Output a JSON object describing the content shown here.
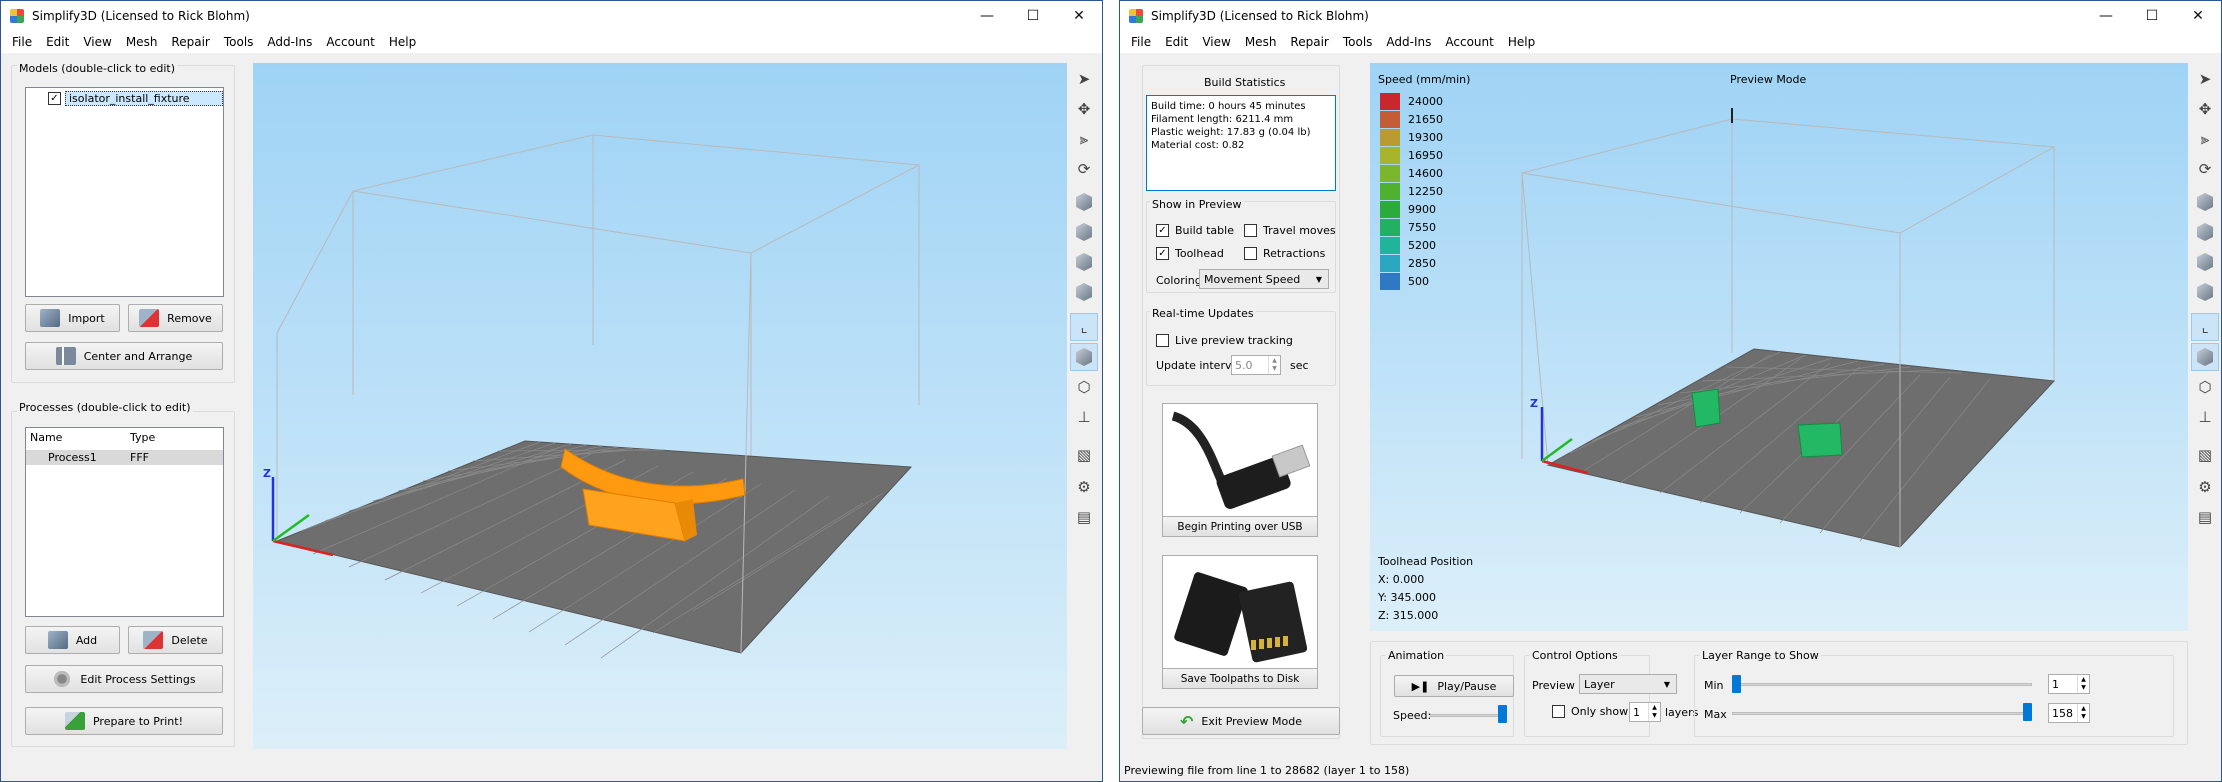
{
  "left": {
    "title": "Simplify3D (Licensed to Rick Blohm)",
    "menu": [
      "File",
      "Edit",
      "View",
      "Mesh",
      "Repair",
      "Tools",
      "Add-Ins",
      "Account",
      "Help"
    ],
    "models_title": "Models (double-click to edit)",
    "model_item": "isolator_install_fixture",
    "import_label": "Import",
    "remove_label": "Remove",
    "center_label": "Center and Arrange",
    "processes_title": "Processes (double-click to edit)",
    "col_name": "Name",
    "col_type": "Type",
    "process_name": "Process1",
    "process_type": "FFF",
    "add_label": "Add",
    "delete_label": "Delete",
    "edit_process_label": "Edit Process Settings",
    "prepare_label": "Prepare to Print!",
    "axis_z": "Z"
  },
  "right": {
    "title": "Simplify3D (Licensed to Rick Blohm)",
    "menu": [
      "File",
      "Edit",
      "View",
      "Mesh",
      "Repair",
      "Tools",
      "Add-Ins",
      "Account",
      "Help"
    ],
    "build_stats_title": "Build Statistics",
    "stats": [
      "Build time: 0 hours 45 minutes",
      "Filament length: 6211.4 mm",
      "Plastic weight: 17.83 g (0.04 lb)",
      "Material cost: 0.82"
    ],
    "show_title": "Show in Preview",
    "build_table": "Build table",
    "toolhead": "Toolhead",
    "travel_moves": "Travel moves",
    "retractions": "Retractions",
    "coloring_label": "Coloring",
    "coloring_value": "Movement Speed",
    "realtime_title": "Real-time Updates",
    "live_tracking": "Live preview tracking",
    "update_interval_label": "Update interval",
    "update_interval_value": "5.0",
    "update_interval_unit": "sec",
    "usb_label": "Begin Printing over USB",
    "sd_label": "Save Toolpaths to Disk",
    "exit_preview": "Exit Preview Mode",
    "preview_mode": "Preview Mode",
    "speed_title": "Speed (mm/min)",
    "legend": [
      {
        "value": "24000",
        "color": "#c8282d"
      },
      {
        "value": "21650",
        "color": "#c45c35"
      },
      {
        "value": "19300",
        "color": "#b99b30"
      },
      {
        "value": "16950",
        "color": "#a7b52c"
      },
      {
        "value": "14600",
        "color": "#7cb62c"
      },
      {
        "value": "12250",
        "color": "#4fb130"
      },
      {
        "value": "9900",
        "color": "#2bab3c"
      },
      {
        "value": "7550",
        "color": "#22b163"
      },
      {
        "value": "5200",
        "color": "#22b49a"
      },
      {
        "value": "2850",
        "color": "#2aa6c0"
      },
      {
        "value": "500",
        "color": "#2f79c4"
      }
    ],
    "toolhead_title": "Toolhead Position",
    "pos_x": "X: 0.000",
    "pos_y": "Y: 345.000",
    "pos_z": "Z: 315.000",
    "animation_title": "Animation",
    "play_pause": "Play/Pause",
    "speed_label": "Speed:",
    "control_title": "Control Options",
    "preview_by_label": "Preview By",
    "preview_by_value": "Layer",
    "only_show": "Only show",
    "only_show_value": "1",
    "layers_label": "layers",
    "layer_range_title": "Layer Range to Show",
    "min_label": "Min",
    "max_label": "Max",
    "min_value": "1",
    "max_value": "158",
    "status": "Previewing file from line 1 to 28682 (layer 1 to 158)",
    "axis_z": "Z"
  },
  "colors": {
    "model_orange": "#ff9a10",
    "toolpath_green": "#22b864",
    "bed_gray": "#6e6e6e",
    "accent_blue": "#0078d7"
  },
  "icons": {
    "toolbar": [
      "select-arrow-icon",
      "move-icon",
      "scale-icon",
      "rotate-icon",
      "view-cube-icon",
      "axes-icon",
      "wireframe-icon",
      "gear-icon"
    ]
  }
}
